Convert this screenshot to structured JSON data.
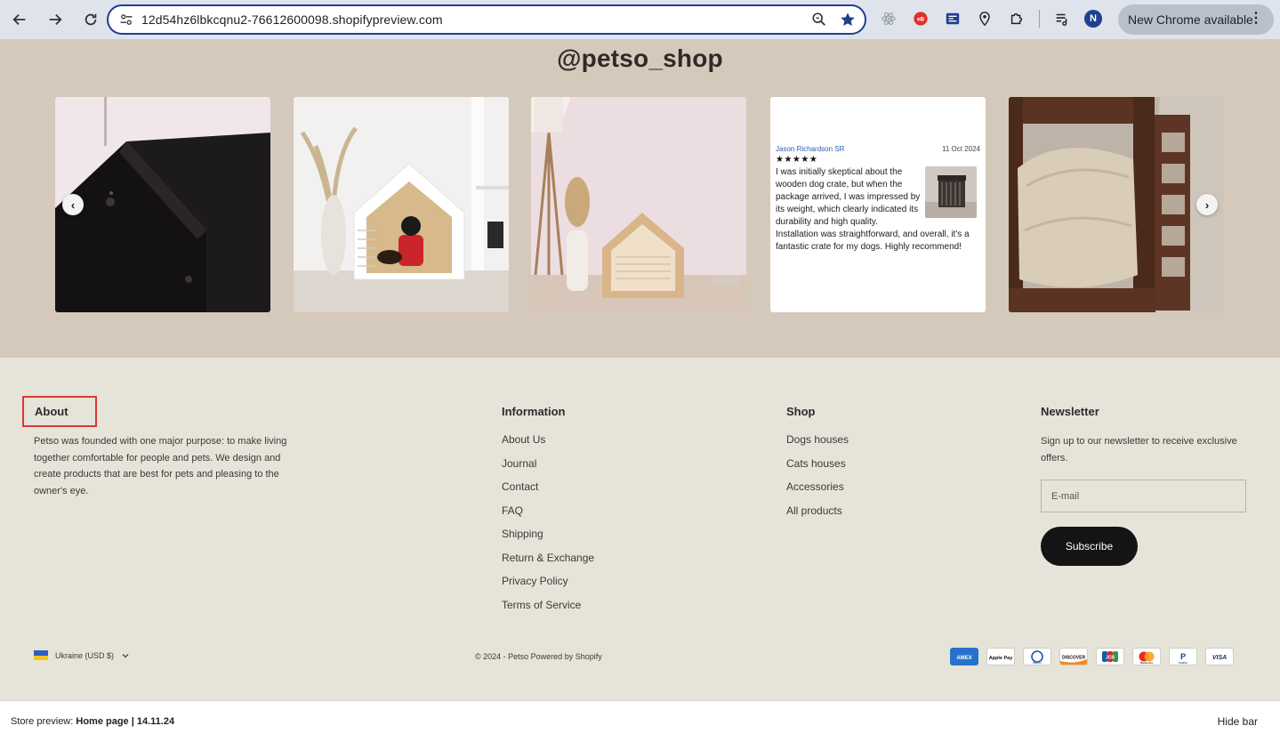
{
  "browser": {
    "url": "12d54hz6lbkcqnu2-76612600098.shopifypreview.com",
    "update_label": "New Chrome available",
    "profile_initial": "N"
  },
  "instagram": {
    "handle": "@petso_shop",
    "review": {
      "name": "Jason Richardson SR",
      "date": "11 Oct 2024",
      "stars": "★★★★★",
      "text": "I was initially skeptical about the wooden dog crate, but when the package arrived, I was impressed by its weight, which clearly indicated its durability and high quality. Installation was straightforward, and overall, it's a fantastic crate for my dogs. Highly recommend!"
    },
    "prev_arrow": "‹",
    "next_arrow": "›"
  },
  "footer": {
    "about": {
      "title": "About",
      "text": "Petso was founded with one major purpose: to make living together comfortable for people and pets. We design and create products that are best for pets and pleasing to the owner's eye."
    },
    "information": {
      "title": "Information",
      "links": [
        "About Us",
        "Journal",
        "Contact",
        "FAQ",
        "Shipping",
        "Return & Exchange",
        "Privacy Policy",
        "Terms of Service"
      ]
    },
    "shop": {
      "title": "Shop",
      "links": [
        "Dogs houses",
        "Cats houses",
        "Accessories",
        "All products"
      ]
    },
    "newsletter": {
      "title": "Newsletter",
      "text": "Sign up to our newsletter to receive exclusive offers.",
      "email_placeholder": "E-mail",
      "subscribe_label": "Subscribe"
    },
    "country": "Ukraine (USD $)",
    "copyright": "© 2024 - Petso Powered by Shopify",
    "payments": [
      "AMEX",
      "Apple Pay",
      "Diners",
      "DISCOVER",
      "JCB",
      "Mastercard",
      "PayPal",
      "VISA"
    ]
  },
  "preview_bar": {
    "prefix": "Store preview: ",
    "page": "Home page | 14.11.24",
    "hide_label": "Hide bar"
  },
  "colors": {
    "band_bg": "#d5c9bc",
    "footer_bg": "#e6e3d8",
    "highlight": "#d93a32",
    "button_dark": "#141414"
  }
}
